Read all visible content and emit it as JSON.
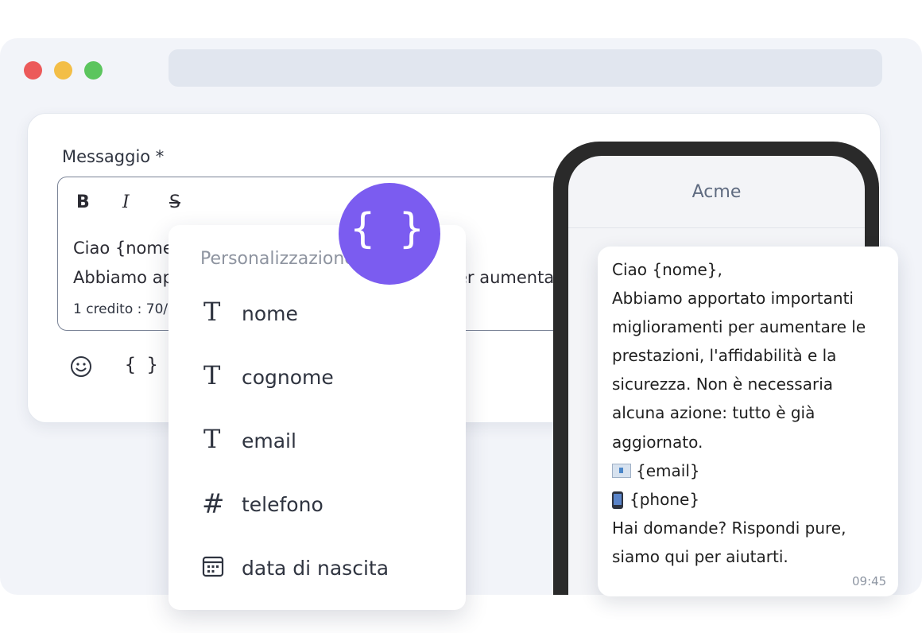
{
  "editor": {
    "label": "Messaggio  *",
    "toolbar": {
      "bold": "B",
      "italic": "I",
      "strike": "S"
    },
    "line1": "Ciao {nome}",
    "line2": "Abbiamo ap",
    "line2_tail": "er aumenta",
    "counter": "1 credito : 70/",
    "insert_variable": "{ }"
  },
  "personalization": {
    "title": "Personalizzazione",
    "items": [
      {
        "label": "nome",
        "icon": "text-icon"
      },
      {
        "label": "cognome",
        "icon": "text-icon"
      },
      {
        "label": "email",
        "icon": "text-icon"
      },
      {
        "label": "telefono",
        "icon": "hash-icon"
      },
      {
        "label": "data di nascita",
        "icon": "calendar-icon"
      }
    ]
  },
  "fab": {
    "label": "{ }",
    "color": "#7b5cf0"
  },
  "preview": {
    "sender": "Acme",
    "lines": [
      "Ciao {nome},",
      "Abbiamo apportato importanti",
      "miglioramenti per aumentare le",
      "prestazioni, l'affidabilità e la",
      "sicurezza. Non è necessaria",
      "alcuna azione: tutto è già",
      "aggiornato."
    ],
    "email_var": "{email}",
    "phone_var": "{phone}",
    "closing": [
      "Hai domande? Rispondi pure,",
      "siamo qui per aiutarti."
    ],
    "time": "09:45"
  }
}
